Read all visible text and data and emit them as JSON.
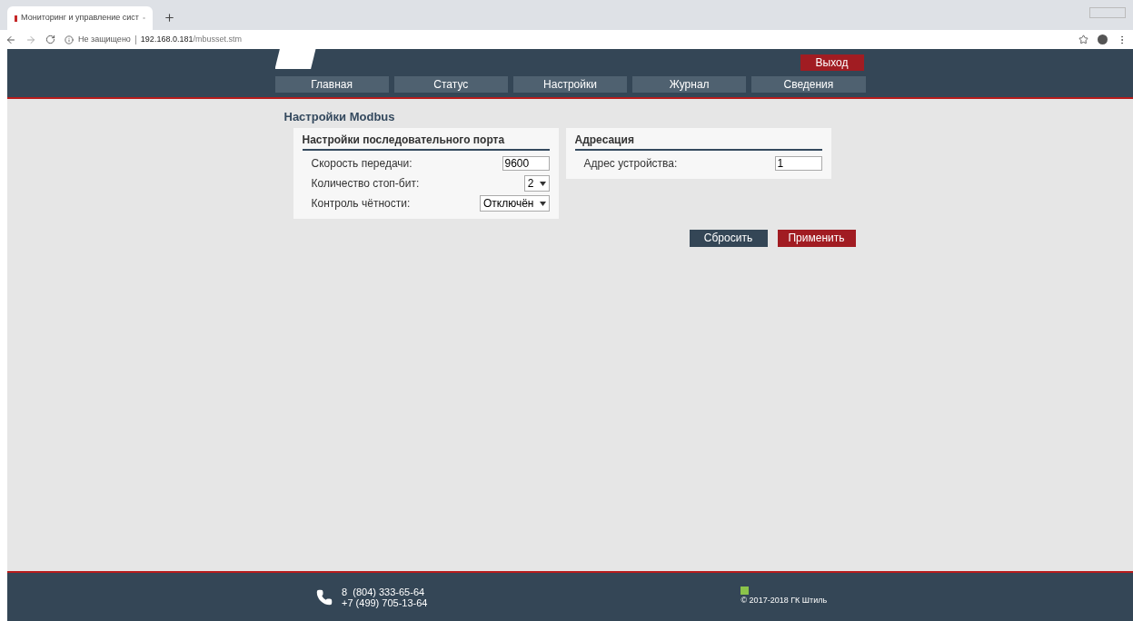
{
  "browser": {
    "tab_title": "Мониторинг и управление сист",
    "security": "Не защищено",
    "url_host": "192.168.0.181",
    "url_path": "/mbusset.stm"
  },
  "header": {
    "logout": "Выход",
    "nav": [
      {
        "label": "Главная",
        "selected": false
      },
      {
        "label": "Статус",
        "selected": false
      },
      {
        "label": "Настройки",
        "selected": false
      },
      {
        "label": "Журнал",
        "selected": false
      },
      {
        "label": "Сведения",
        "selected": false
      }
    ]
  },
  "page_title": "Настройки Modbus",
  "panels": [
    {
      "title": "Настройки последовательного порта",
      "fields": [
        {
          "label": "Скорость передачи:",
          "kind": "input",
          "value": "9600"
        },
        {
          "label": "Количество стоп-бит:",
          "kind": "select",
          "value": "2"
        },
        {
          "label": "Контроль чётности:",
          "kind": "select",
          "value": "Отключён"
        }
      ]
    },
    {
      "title": "Адресация",
      "fields": [
        {
          "label": "Адрес устройства:",
          "kind": "input",
          "value": "1"
        }
      ]
    }
  ],
  "buttons": [
    {
      "label": "Сбросить",
      "kind": "secondary"
    },
    {
      "label": "Применить",
      "kind": "primary"
    }
  ],
  "footer": {
    "phones": [
      "8  (804) 333-65-64",
      "+7 (499) 705-13-64"
    ],
    "copyright": "© 2017-2018 ГК Штиль"
  }
}
